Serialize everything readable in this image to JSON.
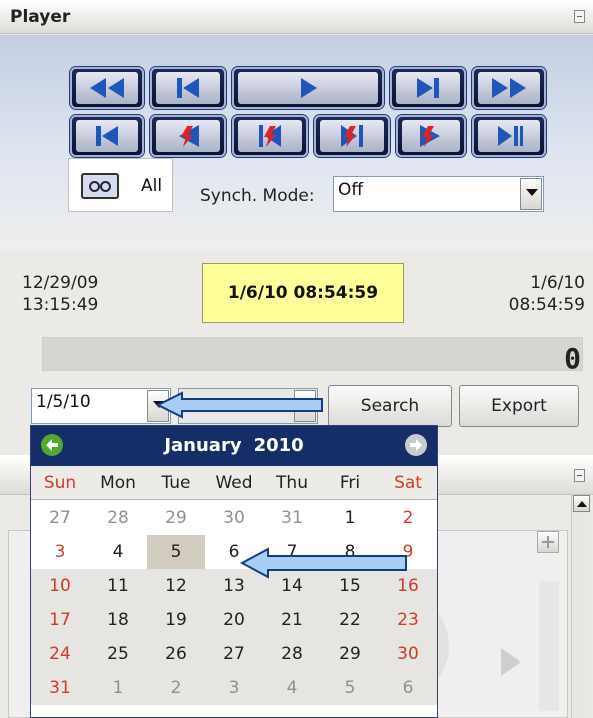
{
  "player": {
    "title": "Player",
    "tape_label": "All",
    "synch_label": "Synch. Mode:",
    "synch_value": "Off",
    "start_date": "12/29/09",
    "start_time": "13:15:49",
    "current": "1/6/10 08:54:59",
    "end_date": "1/6/10",
    "end_time": "08:54:59",
    "counter": "0",
    "date_value": "1/5/10",
    "search_label": "Search",
    "export_label": "Export"
  },
  "icons": {
    "row1": [
      "rewind-icon",
      "step-back-icon",
      "play-icon",
      "step-forward-icon",
      "fast-forward-icon"
    ],
    "row2": [
      "go-to-start-icon",
      "prev-event-icon",
      "prev-marker-icon",
      "next-marker-icon",
      "next-event-icon",
      "go-to-end-icon"
    ]
  },
  "calendar": {
    "month": "January",
    "year": "2010",
    "weekdays": [
      "Sun",
      "Mon",
      "Tue",
      "Wed",
      "Thu",
      "Fri",
      "Sat"
    ],
    "weeks": [
      [
        "27",
        "28",
        "29",
        "30",
        "31",
        "1",
        "2"
      ],
      [
        "3",
        "4",
        "5",
        "6",
        "7",
        "8",
        "9"
      ],
      [
        "10",
        "11",
        "12",
        "13",
        "14",
        "15",
        "16"
      ],
      [
        "17",
        "18",
        "19",
        "20",
        "21",
        "22",
        "23"
      ],
      [
        "24",
        "25",
        "26",
        "27",
        "28",
        "29",
        "30"
      ],
      [
        "31",
        "1",
        "2",
        "3",
        "4",
        "5",
        "6"
      ]
    ],
    "selected_day": "5",
    "colors": {
      "header": "#162e68",
      "weekend": "#d43a2a",
      "other_month": "#909090",
      "prev_nav": "#53a832"
    }
  },
  "annotations": {
    "arrow_color": "#a9cdf5"
  }
}
